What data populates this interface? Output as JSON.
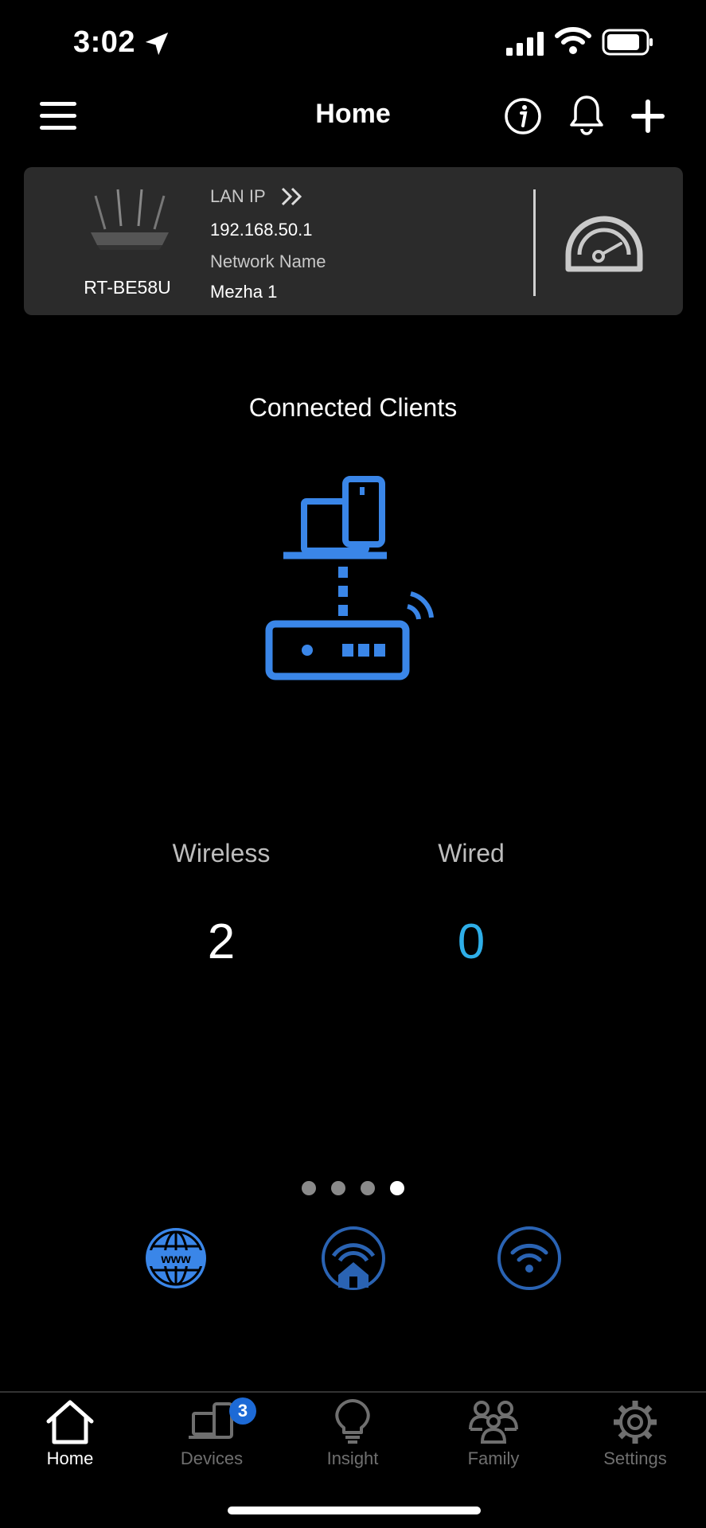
{
  "status_bar": {
    "time": "3:02",
    "icons": [
      "location-arrow-icon",
      "cellular-signal-icon",
      "wifi-icon",
      "battery-icon"
    ]
  },
  "header": {
    "title": "Home",
    "icons": [
      "menu-icon",
      "info-icon",
      "bell-icon",
      "plus-icon"
    ]
  },
  "router": {
    "model": "RT-BE58U",
    "lan_ip_label": "LAN IP",
    "lan_ip": "192.168.50.1",
    "network_name_label": "Network Name",
    "network_name": "Mezha 1",
    "icons": [
      "router-image",
      "double-chevron-right-icon",
      "speedometer-icon"
    ]
  },
  "clients": {
    "title": "Connected Clients",
    "wireless_label": "Wireless",
    "wireless_count": "2",
    "wired_label": "Wired",
    "wired_count": "0",
    "illustration": "devices-router-illustration"
  },
  "pager": {
    "pages": 4,
    "active_page": 4
  },
  "quick_icons": [
    "globe-www-icon",
    "home-wifi-icon",
    "wifi-circle-icon"
  ],
  "tabs": [
    {
      "label": "Home",
      "icon": "home-icon",
      "active": true
    },
    {
      "label": "Devices",
      "icon": "devices-icon",
      "badge": "3"
    },
    {
      "label": "Insight",
      "icon": "lightbulb-icon"
    },
    {
      "label": "Family",
      "icon": "family-icon"
    },
    {
      "label": "Settings",
      "icon": "gear-icon"
    }
  ],
  "colors": {
    "background": "#000000",
    "card": "#2b2b2b",
    "accent_blue": "#3a86e8",
    "wired_count": "#2eaee8",
    "badge": "#1d6ad6",
    "inactive_tab": "#6f6f6f"
  }
}
